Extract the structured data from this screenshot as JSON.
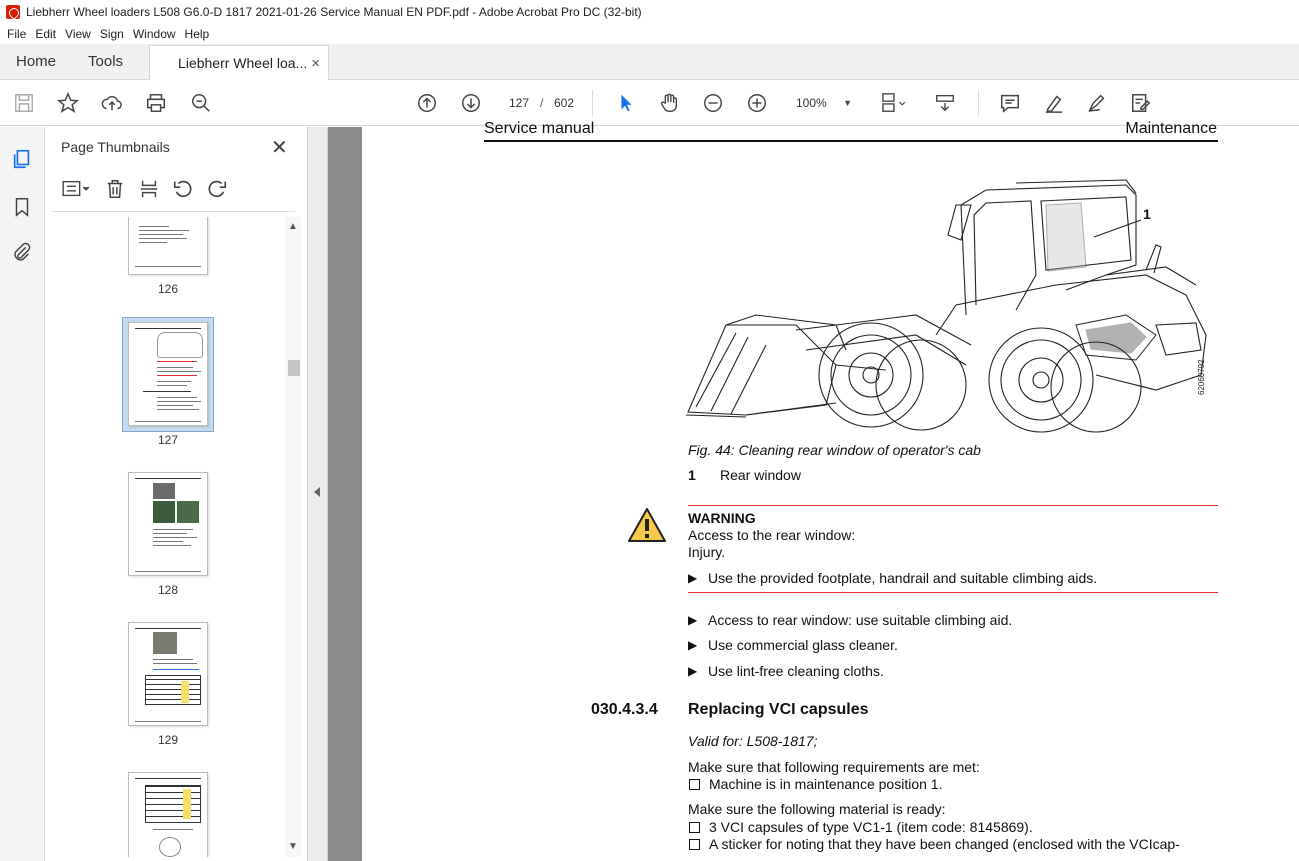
{
  "window": {
    "title": "Liebherr Wheel loaders L508 G6.0-D 1817 2021-01-26 Service Manual EN PDF.pdf - Adobe Acrobat Pro DC (32-bit)"
  },
  "menu": [
    "File",
    "Edit",
    "View",
    "Sign",
    "Window",
    "Help"
  ],
  "tabs": {
    "home": "Home",
    "tools": "Tools",
    "document": "Liebherr Wheel loa...",
    "close": "×"
  },
  "toolbar": {
    "current_page": "127",
    "separator": "/",
    "total_pages": "602",
    "zoom": "100%"
  },
  "thumbnails": {
    "title": "Page Thumbnails",
    "close": "✕",
    "pages": [
      {
        "label": "126"
      },
      {
        "label": "127",
        "selected": true
      },
      {
        "label": "128"
      },
      {
        "label": "129"
      }
    ]
  },
  "page": {
    "header_left": "Service manual",
    "header_right": "Maintenance",
    "figure_callout": "1",
    "figure_code": "62060792",
    "caption": "Fig. 44: Cleaning rear window of operator's cab",
    "legend": {
      "num": "1",
      "text": "Rear window"
    },
    "warning": {
      "title": "WARNING",
      "line1": "Access to the rear window:",
      "line2": "Injury.",
      "action": "Use the provided footplate, handrail and suitable climbing aids."
    },
    "steps": [
      "Access to rear window: use suitable climbing aid.",
      "Use commercial glass cleaner.",
      "Use lint-free cleaning cloths."
    ],
    "section": {
      "number": "030.4.3.4",
      "title": "Replacing VCI capsules",
      "valid_for": "Valid for: L508-1817;",
      "req_intro": "Make sure that following requirements are met:",
      "req_items": [
        "Machine is in maintenance position 1."
      ],
      "mat_intro": "Make sure the following material is ready:",
      "mat_items": [
        "3 VCI capsules of type VC1-1 (item code: 8145869).",
        "A sticker for noting that they have been changed (enclosed with the VCIcap-"
      ]
    }
  },
  "colors": {
    "warning_red": "#e03030",
    "acrobat_red": "#d81e05",
    "select_blue": "#c5dcef"
  }
}
